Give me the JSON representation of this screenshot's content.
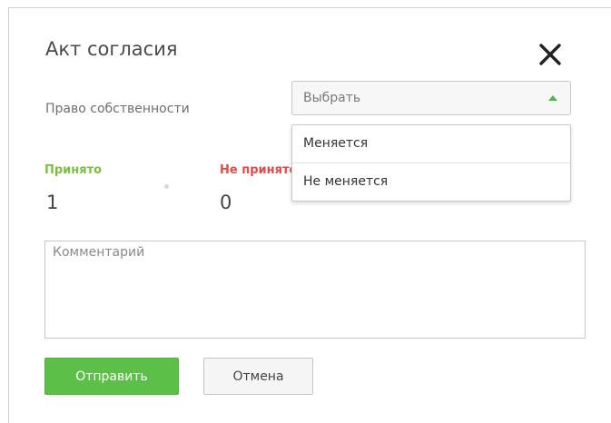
{
  "dialog": {
    "title": "Акт согласия",
    "close_icon": "close-icon"
  },
  "ownership": {
    "label": "Право собственности",
    "select": {
      "value": "Выбрать",
      "caret_icon": "caret-up-icon",
      "caret_color": "#4cb848",
      "options": [
        "Меняется",
        "Не меняется"
      ]
    }
  },
  "status": {
    "accepted": {
      "label": "Принято",
      "value": "1",
      "color": "#7bc043"
    },
    "rejected": {
      "label": "Не принято",
      "value": "0",
      "color": "#e04b4b"
    }
  },
  "comment": {
    "placeholder": "Комментарий",
    "value": ""
  },
  "actions": {
    "submit_label": "Отправить",
    "submit_color": "#5cbf47",
    "cancel_label": "Отмена"
  }
}
